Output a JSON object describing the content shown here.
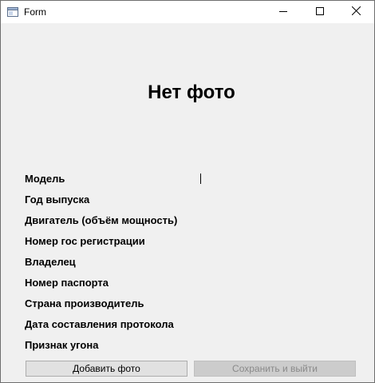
{
  "window": {
    "title": "Form"
  },
  "photo": {
    "placeholder_text": "Нет фото"
  },
  "fields": [
    {
      "label": "Модель"
    },
    {
      "label": "Год выпуска"
    },
    {
      "label": "Двигатель (объём мощность)"
    },
    {
      "label": "Номер гос регистрации"
    },
    {
      "label": "Владелец"
    },
    {
      "label": "Номер паспорта"
    },
    {
      "label": "Страна производитель"
    },
    {
      "label": "Дата составления протокола"
    },
    {
      "label": "Признак угона"
    }
  ],
  "buttons": {
    "add_photo": "Добавить фото",
    "save_exit": "Сохранить и выйти",
    "save_exit_enabled": false
  },
  "icons": {
    "app": "form-window-icon",
    "minimize": "minimize-icon",
    "maximize": "maximize-icon",
    "close": "close-icon"
  }
}
